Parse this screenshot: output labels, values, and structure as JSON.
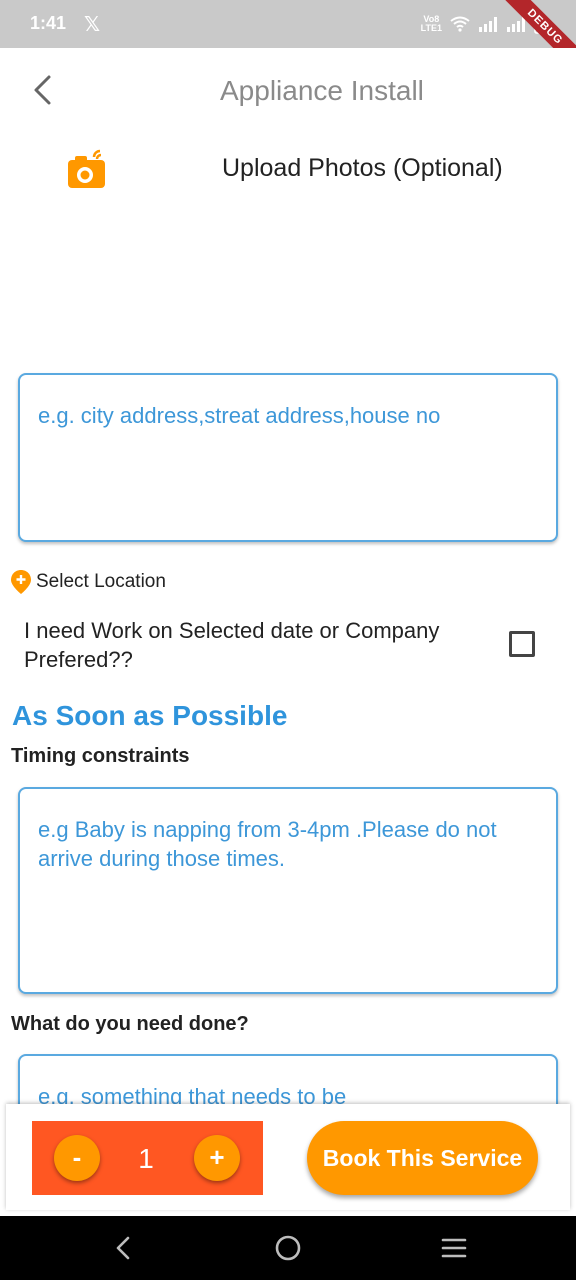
{
  "status_bar": {
    "time": "1:41",
    "app_icon": "x-logo-icon",
    "volte_line1": "Vo8",
    "volte_line2": "LTE1"
  },
  "debug_banner": "DEBUG",
  "app_bar": {
    "title": "Appliance Install",
    "back_icon": "chevron-left-icon"
  },
  "upload": {
    "label": "Upload Photos (Optional)",
    "icon": "camera-icon",
    "icon_color": "#ff9800"
  },
  "address": {
    "placeholder": "e.g. city address,streat address,house no"
  },
  "location": {
    "label": "Select Location",
    "icon": "location-pin-icon"
  },
  "work_date": {
    "label": "I need Work on Selected date or Company Prefered??",
    "checked": false
  },
  "schedule_heading": "As Soon as Possible",
  "timing": {
    "label": "Timing constraints",
    "placeholder": "e.g Baby is napping from 3-4pm .Please do not arrive during those times."
  },
  "needs": {
    "label": "What do you need done?",
    "placeholder": "e.g. something that needs to be"
  },
  "quantity": {
    "minus": "-",
    "value": "1",
    "plus": "+"
  },
  "book_button": "Book This Service",
  "colors": {
    "accent_blue": "#2f94dc",
    "orange": "#ff9800",
    "deep_orange": "#ff5722"
  }
}
